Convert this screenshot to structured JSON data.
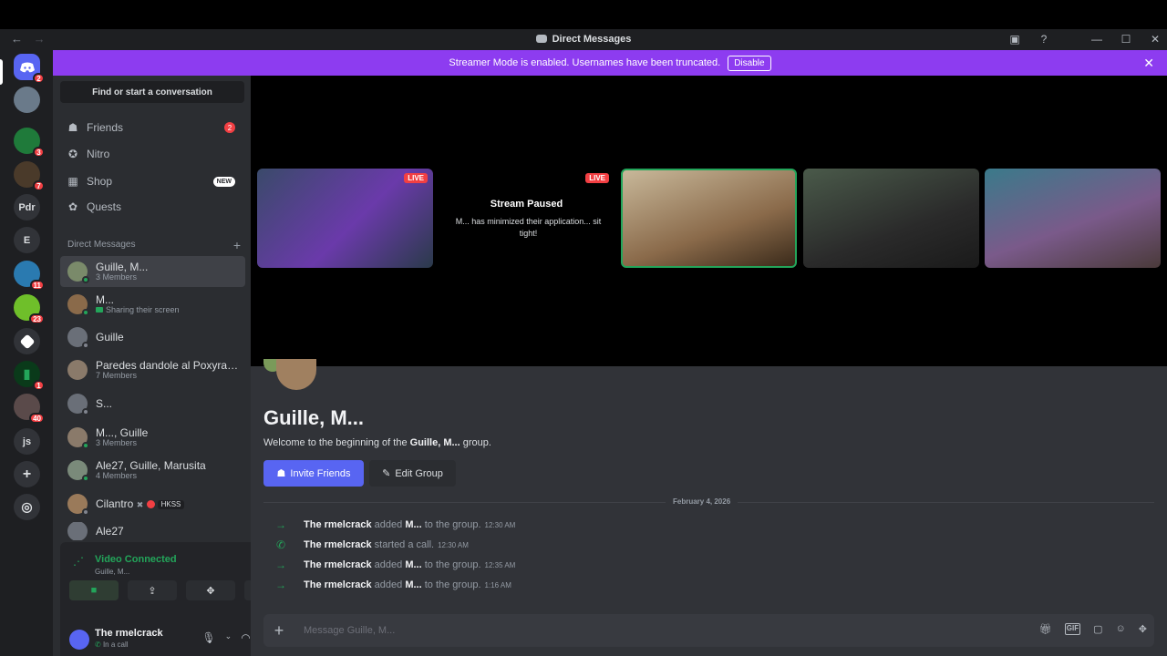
{
  "window": {
    "title": "Direct Messages",
    "back": "←",
    "forward": "→",
    "controls": {
      "inbox": "▣",
      "help": "?",
      "minimize": "—",
      "maximize": "☐",
      "close": "✕"
    }
  },
  "banner": {
    "text": "Streamer Mode is enabled. Usernames have been truncated.",
    "button": "Disable",
    "close": "✕"
  },
  "servers": [
    {
      "label": "",
      "badge": "2"
    },
    {
      "label": "",
      "badge": ""
    },
    {
      "label": "",
      "badge": "3"
    },
    {
      "label": "",
      "badge": "7"
    },
    {
      "label": "Pdr",
      "badge": ""
    },
    {
      "label": "E",
      "badge": ""
    },
    {
      "label": "",
      "badge": "11"
    },
    {
      "label": "",
      "badge": "23"
    },
    {
      "label": "",
      "badge": ""
    },
    {
      "label": "",
      "badge": "1"
    },
    {
      "label": "",
      "badge": "40"
    },
    {
      "label": "js",
      "badge": ""
    },
    {
      "label": "+",
      "badge": ""
    },
    {
      "label": "◎",
      "badge": ""
    }
  ],
  "sidebar": {
    "search": "Find or start a conversation",
    "nav": [
      {
        "label": "Friends",
        "icon": "friends-icon",
        "glyph": "☗",
        "badge": "2"
      },
      {
        "label": "Nitro",
        "icon": "nitro-icon",
        "glyph": "✪",
        "badge": ""
      },
      {
        "label": "Shop",
        "icon": "shop-icon",
        "glyph": "▦",
        "tag": "NEW"
      },
      {
        "label": "Quests",
        "icon": "quests-icon",
        "glyph": "✿",
        "badge": ""
      }
    ],
    "dm_header": "Direct Messages",
    "dm_plus": "+",
    "dms": [
      {
        "name": "Guille, M...",
        "sub": "3 Members"
      },
      {
        "name": "M...",
        "sub": "Sharing their screen"
      },
      {
        "name": "Guille",
        "sub": ""
      },
      {
        "name": "Paredes dandole al Poxyram, ...",
        "sub": "7 Members"
      },
      {
        "name": "S...",
        "sub": ""
      },
      {
        "name": "M..., Guille",
        "sub": "3 Members"
      },
      {
        "name": "Ale27, Guille, Marusita",
        "sub": "4 Members"
      },
      {
        "name": "Cilantro",
        "tag": "HKSS",
        "sub": ""
      },
      {
        "name": "Ale27",
        "sub": ""
      }
    ]
  },
  "voice": {
    "status": "Video Connected",
    "channel": "Guille, M...",
    "buttons": [
      "■",
      "⇪",
      "✥",
      "✦"
    ]
  },
  "user": {
    "name": "The rmelcrack",
    "status": "In a call"
  },
  "stage": {
    "tiles": [
      {
        "live": "LIVE"
      },
      {
        "live": "LIVE",
        "paused_title": "Stream Paused",
        "paused_sub": "M... has minimized their application... sit tight!"
      },
      {
        "live": ""
      },
      {
        "live": ""
      },
      {
        "live": ""
      }
    ]
  },
  "chat": {
    "title": "Guille, M...",
    "welcome_prefix": "Welcome to the beginning of the",
    "welcome_name": "Guille, M...",
    "welcome_suffix": "group.",
    "invite_button": "Invite Friends",
    "edit_button": "Edit Group",
    "date": "February 4, 2026",
    "messages": [
      {
        "icon": "→",
        "user": "The rmelcrack",
        "action": "added",
        "target": "M...",
        "rest": "to the group.",
        "time": "12:30 AM"
      },
      {
        "icon": "✆",
        "user": "The rmelcrack",
        "action": "started a call.",
        "target": "",
        "rest": "",
        "time": "12:30 AM"
      },
      {
        "icon": "→",
        "user": "The rmelcrack",
        "action": "added",
        "target": "M...",
        "rest": "to the group.",
        "time": "12:35 AM"
      },
      {
        "icon": "→",
        "user": "The rmelcrack",
        "action": "added",
        "target": "M...",
        "rest": "to the group.",
        "time": "1:16 AM"
      }
    ],
    "input_placeholder": "Message Guille, M..."
  },
  "colors": {
    "banner": "#8d3cf0",
    "accent": "#5865f2",
    "online": "#23a55a",
    "badge": "#f23f43"
  }
}
